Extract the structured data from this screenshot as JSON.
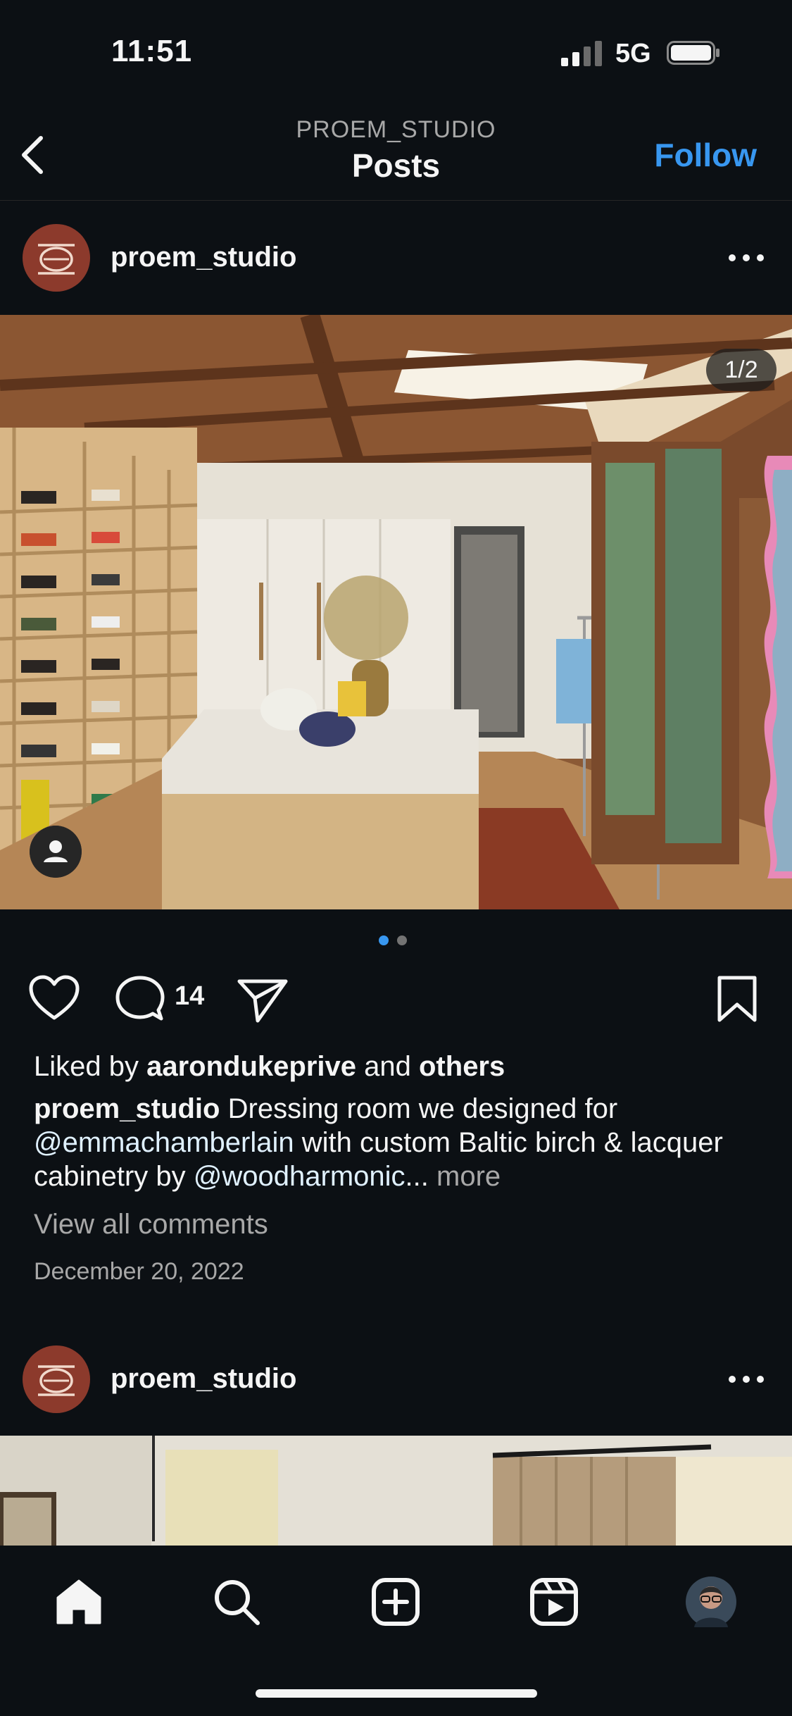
{
  "status_bar": {
    "time": "11:51",
    "network": "5G"
  },
  "nav": {
    "subtitle": "PROEM_STUDIO",
    "title": "Posts",
    "follow_label": "Follow"
  },
  "post1": {
    "username": "proem_studio",
    "counter": "1/2",
    "comment_count": "14",
    "liked_prefix": "Liked by",
    "liked_user": "aarondukeprive",
    "liked_and": "and",
    "liked_others": "others",
    "caption_user": "proem_studio",
    "caption_text1": "Dressing room we designed for",
    "mention1": "@emmachamberlain",
    "caption_text2": "with custom Baltic birch & lacquer cabinetry by",
    "mention2": "@woodharmonic",
    "ellipsis": "...",
    "more_label": "more",
    "view_comments": "View all comments",
    "date": "December 20, 2022"
  },
  "post2": {
    "username": "proem_studio"
  },
  "colors": {
    "background": "#0c1014",
    "accent": "#3897f0",
    "mention": "#e0f1ff",
    "secondary_text": "#a8a8a8"
  },
  "icons": [
    "chevron-left-icon",
    "ellipsis-icon",
    "heart-icon",
    "comment-icon",
    "share-icon",
    "bookmark-icon",
    "home-icon",
    "search-icon",
    "create-icon",
    "reels-icon",
    "profile-avatar"
  ]
}
